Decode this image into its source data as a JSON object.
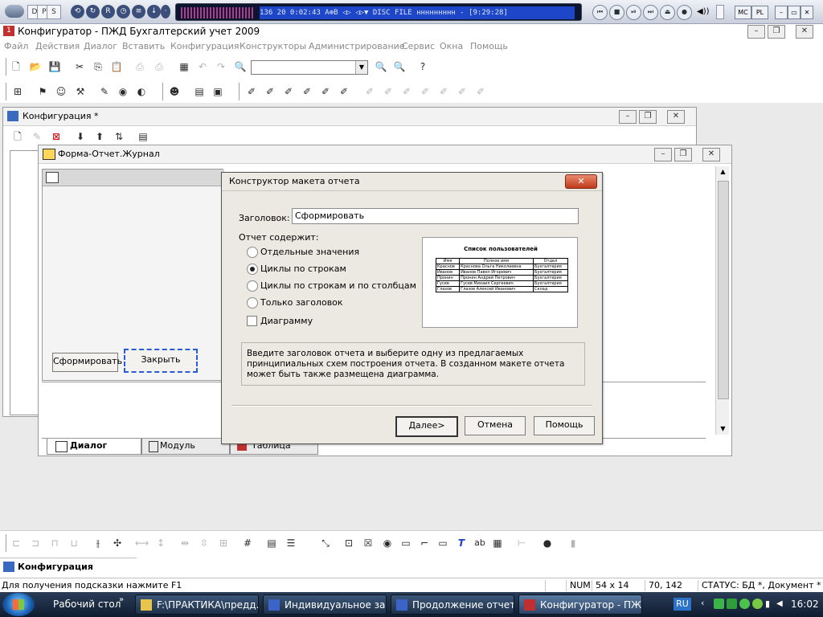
{
  "mediabar": {
    "tiles": [
      "D",
      "P",
      "S"
    ],
    "lcd_time": "136   20   0:02:43   A⊕B  ◁▷ ◁▷▼  DISC  FILE   ннннннннн - [9:29:28]",
    "right_buttons": [
      "MC",
      "PL"
    ]
  },
  "app": {
    "title": "Конфигуратор - ПЖД Бухгалтерский учет 2009"
  },
  "menu": [
    "Файл",
    "Действия",
    "Диалог",
    "Вставить",
    "Конфигурация",
    "Конструкторы",
    "Администрирование",
    "Сервис",
    "Окна",
    "Помощь"
  ],
  "toolbar1": {
    "combo_value": ""
  },
  "config_window": {
    "title": "Конфигурация *"
  },
  "form_window": {
    "title": "Форма-Отчет.Журнал",
    "btn_form": "Сформировать",
    "btn_close": "Закрыть",
    "tabs": [
      "Диалог",
      "Модуль",
      "Таблица"
    ]
  },
  "dialog": {
    "title": "Конструктор макета отчета",
    "header_label": "Заголовок:",
    "header_value": "Сформировать",
    "contains_label": "Отчет содержит:",
    "options": [
      "Отдельные значения",
      "Циклы по строкам",
      "Циклы по строкам и по столбцам",
      "Только заголовок"
    ],
    "selected_option": 1,
    "checkbox_label": "Диаграмму",
    "checkbox_checked": false,
    "preview": {
      "title": "Список пользователей",
      "headers": [
        "Имя",
        "Полное имя",
        "Отдел"
      ],
      "rows": [
        [
          "Краснов",
          "Краснова Ольга Николаевна",
          "Бухгалтерия"
        ],
        [
          "Иванов",
          "Иванов Павел Игоревич",
          "Бухгалтерия"
        ],
        [
          "Пронин",
          "Пронин Андрей Петрович",
          "Бухгалтерия"
        ],
        [
          "Гусев",
          "Гусев Михаил Сергеевич",
          "Бухгалтерия"
        ],
        [
          "Глазов",
          "Глазов Алексей Иванович",
          "Склад"
        ]
      ]
    },
    "help_text": "Введите заголовок отчета и выберите одну из предлагаемых принципиальных схем построения отчета. В созданном макете отчета может быть также размещена диаграмма.",
    "btn_next": "Далее>",
    "btn_cancel": "Отмена",
    "btn_help": "Помощь"
  },
  "config_tab": "Конфигурация",
  "status": {
    "hint": "Для получения подсказки нажмите F1",
    "num": "NUM",
    "size": "54 x 14",
    "coords": "70, 142",
    "state": "СТАТУС: БД *, Документ *"
  },
  "taskbar": {
    "desktop": "Рабочий стол",
    "items": [
      "F:\\ПРАКТИКА\\предд...",
      "Индивидуальное за...",
      "Продолжение отчет...",
      "Конфигуратор - ПЖ..."
    ],
    "lang": "RU",
    "clock": "16:02"
  }
}
